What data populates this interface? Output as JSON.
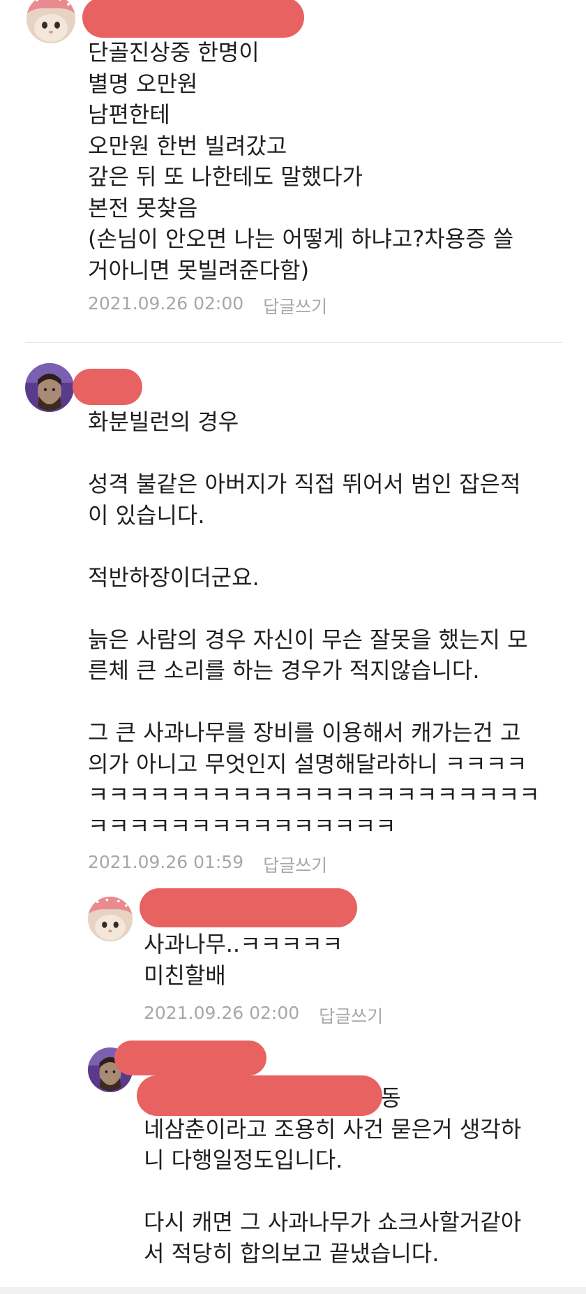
{
  "comments": [
    {
      "body": "단골진상중 한명이\n별명 오만원\n남편한테\n오만원 한번 빌려갔고\n갚은 뒤 또 나한테도 말했다가\n본전 못찾음\n(손님이 안오면 나는 어떻게 하냐고?차용증 쓸\n거아니면 못빌려준다함)",
      "date": "2021.09.26 02:00",
      "reply_label": "답글쓰기"
    },
    {
      "body": "화분빌런의 경우\n\n성격 불같은 아버지가 직접 뛰어서 범인 잡은적\n이 있습니다.\n\n적반하장이더군요.\n\n늙은 사람의 경우 자신이 무슨 잘못을 했는지 모\n른체 큰 소리를 하는 경우가 적지않습니다.\n\n그 큰 사과나무를 장비를 이용해서 캐가는건 고\n의가 아니고 무엇인지 설명해달라하니 ㅋㅋㅋㅋ\nㅋㅋㅋㅋㅋㅋㅋㅋㅋㅋㅋㅋㅋㅋㅋㅋㅋㅋㅋㅋㅋㅋ\nㅋㅋㅋㅋㅋㅋㅋㅋㅋㅋㅋㅋㅋㅋㅋ",
      "date": "2021.09.26 01:59",
      "reply_label": "답글쓰기"
    },
    {
      "body": "사과나무..ㅋㅋㅋㅋㅋ\n미친할배",
      "date": "2021.09.26 02:00",
      "reply_label": "답글쓰기"
    },
    {
      "body": "              아버지 성격에 동\n네삼춘이라고 조용히 사건 묻은거 생각하\n니 다행일정도입니다.\n\n다시 캐면 그 사과나무가 쇼크사할거같아\n서 적당히 합의보고 끝냈습니다."
    }
  ],
  "colors": {
    "redaction": "#e96262",
    "meta": "#a7a7a7",
    "text": "#1f1f1f"
  },
  "avatars": [
    "cat-strawberry-hat-avatar",
    "bearded-man-purple-avatar"
  ]
}
